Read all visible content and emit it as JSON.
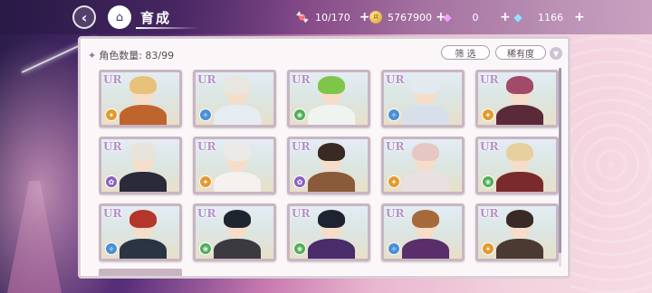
{
  "header": {
    "title": "育成",
    "back_icon": "chevron-left-icon",
    "home_icon": "castle-home-icon"
  },
  "resources": [
    {
      "name": "stamina",
      "icon": "candy-icon",
      "value": "10/170"
    },
    {
      "name": "gold",
      "icon": "coin-icon",
      "value": "5767900"
    },
    {
      "name": "paid-gem",
      "icon": "pink-diamond-icon",
      "value": "0"
    },
    {
      "name": "free-gem",
      "icon": "blue-diamond-icon",
      "value": "1166"
    }
  ],
  "panel": {
    "count_label": "角色数量: 83/99",
    "filter_label": "筛 选",
    "rarity_label": "稀有度",
    "sort_icon": "chevron-down-icon"
  },
  "rarity_badge": "UR",
  "cards": [
    {
      "attr": "orange",
      "hair": "#e9c27a",
      "outfit": "#c0642e"
    },
    {
      "attr": "blue",
      "hair": "#e8e6df",
      "outfit": "#e6ecf2"
    },
    {
      "attr": "green",
      "hair": "#7dc64a",
      "outfit": "#f0f4f0"
    },
    {
      "attr": "blue",
      "hair": "#e4e9ef",
      "outfit": "#d7e0ea"
    },
    {
      "attr": "orange",
      "hair": "#a24a6a",
      "outfit": "#5a2a3a"
    },
    {
      "attr": "purple",
      "hair": "#e7e4dc",
      "outfit": "#2a2a3a"
    },
    {
      "attr": "orange",
      "hair": "#ede9e8",
      "outfit": "#f4f1ee"
    },
    {
      "attr": "purple",
      "hair": "#3a2a24",
      "outfit": "#8a5a3a"
    },
    {
      "attr": "orange",
      "hair": "#e8c6c4",
      "outfit": "#e9e0e2"
    },
    {
      "attr": "green",
      "hair": "#e7cf9e",
      "outfit": "#7a2a2a"
    },
    {
      "attr": "blue",
      "hair": "#b4362a",
      "outfit": "#2b3442"
    },
    {
      "attr": "green",
      "hair": "#1e2430",
      "outfit": "#3a3a40"
    },
    {
      "attr": "green",
      "hair": "#1f2230",
      "outfit": "#4a2c6a"
    },
    {
      "attr": "blue",
      "hair": "#a56a3a",
      "outfit": "#5a2e6a"
    },
    {
      "attr": "orange",
      "hair": "#3a2a26",
      "outfit": "#4a3a32"
    }
  ]
}
